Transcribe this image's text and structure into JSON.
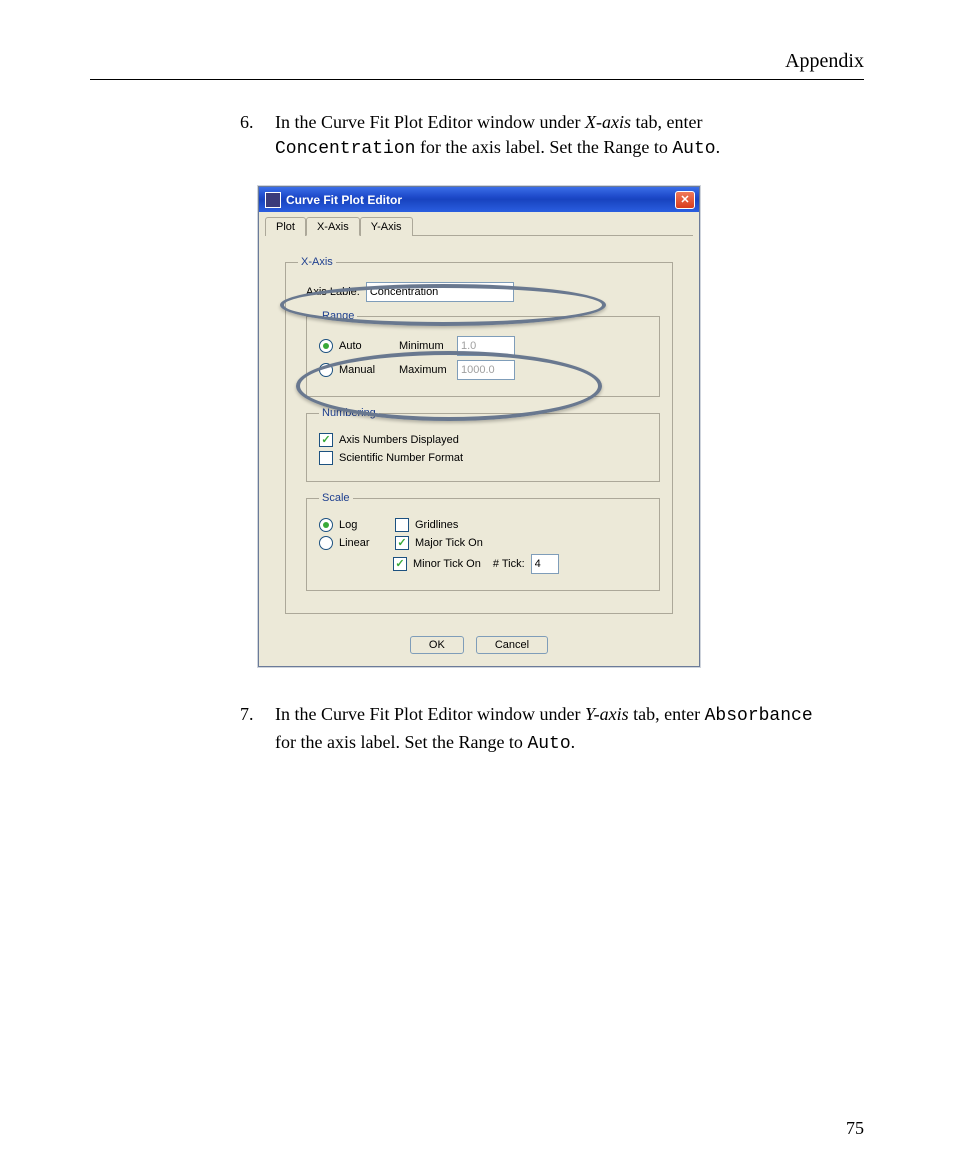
{
  "page": {
    "header": "Appendix",
    "page_number": "75"
  },
  "steps": {
    "s6_num": "6.",
    "s6_a": "In the Curve Fit Plot Editor window under ",
    "s6_b_italic": "X-axis",
    "s6_c": " tab, enter ",
    "s6_d_mono": "Concentration",
    "s6_e": " for the axis label. Set the Range to ",
    "s6_f_mono": "Auto",
    "s6_g": ".",
    "s7_num": "7.",
    "s7_a": "In the Curve Fit Plot Editor window under ",
    "s7_b_italic": "Y-axis",
    "s7_c": " tab, enter ",
    "s7_d_mono": "Absorbance",
    "s7_e": " for the axis label. Set the Range to ",
    "s7_f_mono": "Auto",
    "s7_g": "."
  },
  "dialog": {
    "title": "Curve Fit Plot Editor",
    "tabs": {
      "plot": "Plot",
      "xaxis": "X-Axis",
      "yaxis": "Y-Axis"
    },
    "group_xaxis": "X-Axis",
    "axis_label_label": "Axis Lable:",
    "axis_label_value": "Concentration",
    "group_range": "Range",
    "range_auto": "Auto",
    "range_manual": "Manual",
    "range_min_label": "Minimum",
    "range_min_value": "1.0",
    "range_max_label": "Maximum",
    "range_max_value": "1000.0",
    "group_numbering": "Numbering",
    "numbering_axis": "Axis Numbers Displayed",
    "numbering_sci": "Scientific Number Format",
    "group_scale": "Scale",
    "scale_log": "Log",
    "scale_linear": "Linear",
    "scale_gridlines": "Gridlines",
    "scale_major": "Major Tick On",
    "scale_minor": "Minor Tick On",
    "tick_label": "# Tick:",
    "tick_value": "4",
    "ok": "OK",
    "cancel": "Cancel"
  }
}
